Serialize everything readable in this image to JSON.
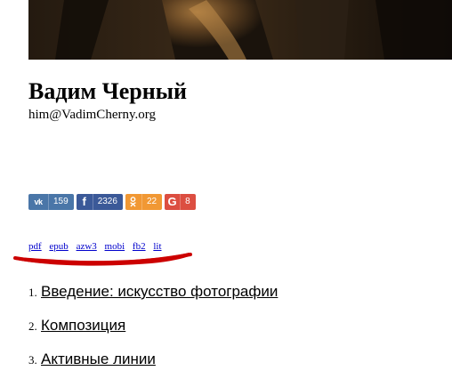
{
  "author": {
    "name": "Вадим Черный",
    "email": "him@VadimCherny.org"
  },
  "share": [
    {
      "network": "vkontakte",
      "icon": "vk-icon",
      "icon_text": "vk",
      "count": "159",
      "color": "#4a76a8"
    },
    {
      "network": "facebook",
      "icon": "facebook-icon",
      "icon_text": "f",
      "count": "2326",
      "color": "#3b5998"
    },
    {
      "network": "odnoklassniki",
      "icon": "odnoklassniki-icon",
      "icon_text": "ок",
      "count": "22",
      "color": "#ee8208"
    },
    {
      "network": "google-plus",
      "icon": "google-icon",
      "icon_text": "G",
      "count": "8",
      "color": "#dc4e41"
    }
  ],
  "formats": [
    "pdf",
    "epub",
    "azw3",
    "mobi",
    "fb2",
    "lit"
  ],
  "toc": [
    {
      "number": "1.",
      "title": "Введение: искусство фотографии"
    },
    {
      "number": "2.",
      "title": "Композиция"
    },
    {
      "number": "3.",
      "title": "Активные линии"
    }
  ],
  "colors": {
    "link": "#0000cc",
    "annotation_stroke": "#cc0000"
  }
}
